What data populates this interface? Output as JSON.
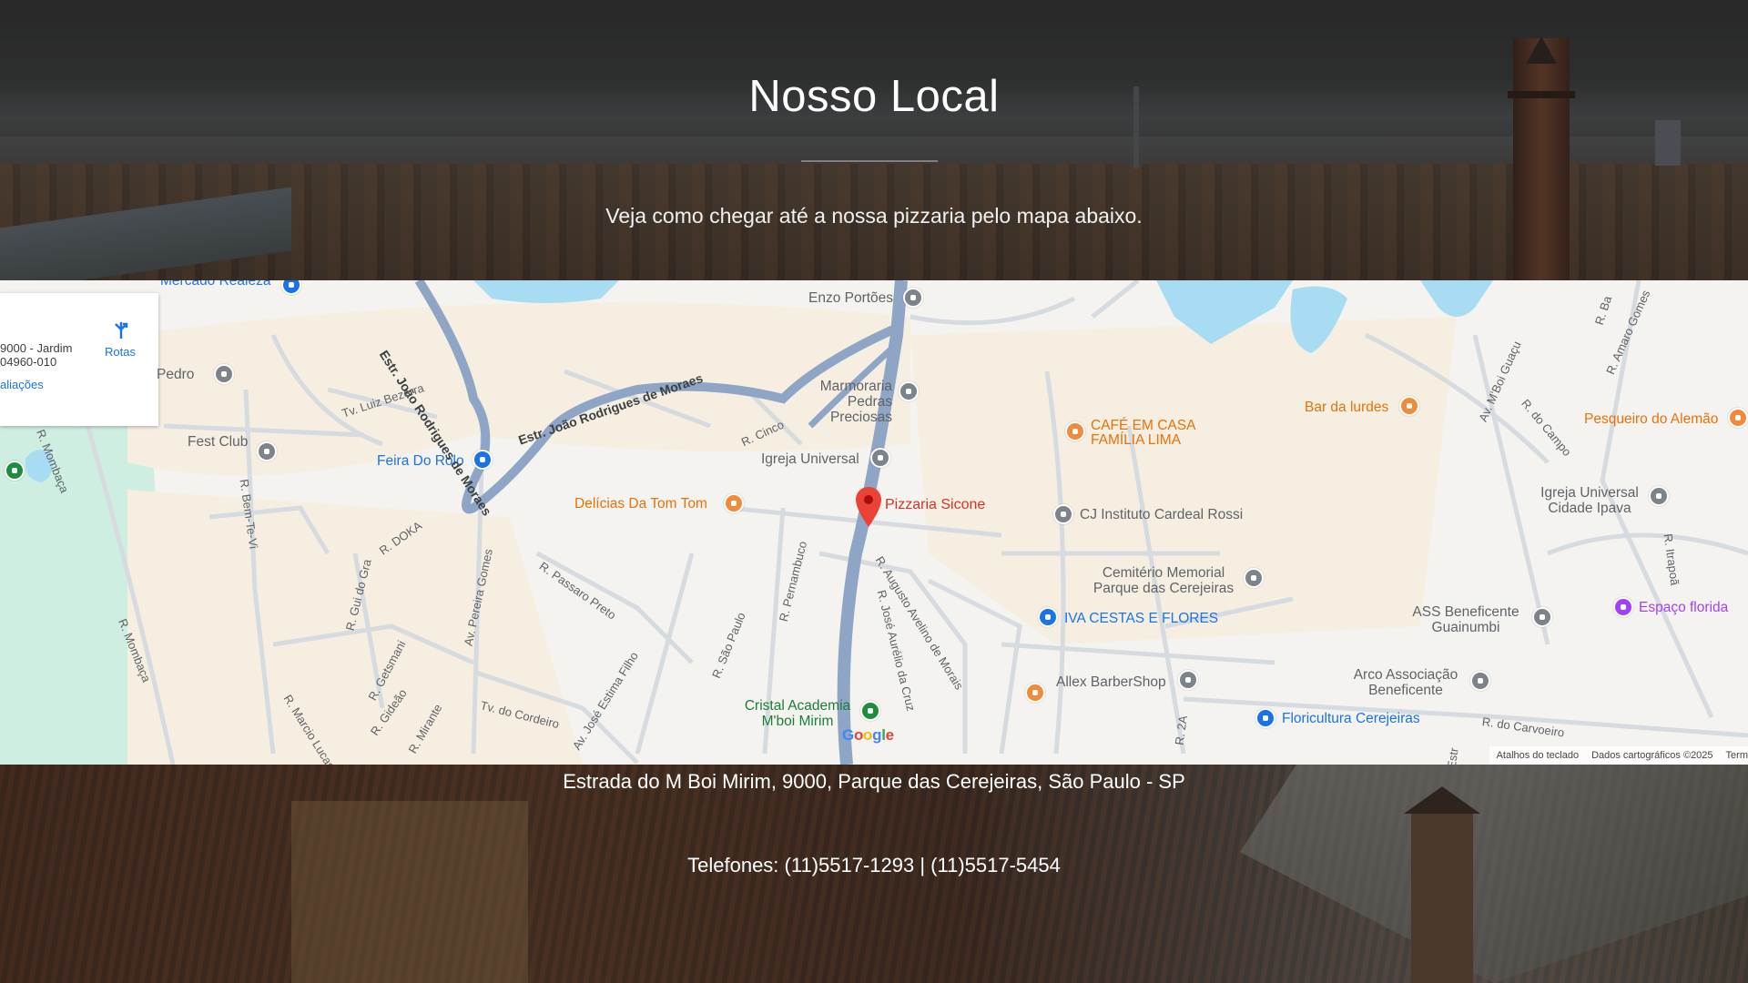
{
  "hero": {
    "title": "Nosso Local",
    "subtitle": "Veja como chegar até a nossa pizzaria pelo mapa abaixo."
  },
  "map": {
    "infocard": {
      "address_line1": "9000 - Jardim",
      "address_line2": "04960-010",
      "reviews_link": "aliações",
      "directions_label": "Rotas"
    },
    "pois": [
      {
        "name": "Mercado Realeza",
        "color": "blue"
      },
      {
        "name": "Enzo Portões",
        "color": "gray"
      },
      {
        "name": "Pedro",
        "color": "gray"
      },
      {
        "name": "Marmoraria Pedras Preciosas",
        "color": "gray"
      },
      {
        "name": "Fest Club",
        "color": "gray"
      },
      {
        "name": "Feira Do Rolo",
        "color": "blue"
      },
      {
        "name": "Igreja Universal",
        "color": "gray"
      },
      {
        "name": "Delícias Da Tom Tom",
        "color": "orange"
      },
      {
        "name": "CAFÉ EM CASA FAMÍLIA LIMA",
        "color": "orange"
      },
      {
        "name": "Bar da lurdes",
        "color": "orange"
      },
      {
        "name": "Pesqueiro do Alemão",
        "color": "orange"
      },
      {
        "name": "CJ Instituto Cardeal Rossi",
        "color": "gray"
      },
      {
        "name": "Igreja Universal Cidade Ipava",
        "color": "gray"
      },
      {
        "name": "Cemitério Memorial Parque das Cerejeiras",
        "color": "gray"
      },
      {
        "name": "IVA CESTAS E FLORES",
        "color": "blue"
      },
      {
        "name": "ASS Beneficente Guainumbi",
        "color": "gray"
      },
      {
        "name": "Espaço florida",
        "color": "purple"
      },
      {
        "name": "Allex BarberShop",
        "color": "gray"
      },
      {
        "name": "Arco Associação Beneficente",
        "color": "gray"
      },
      {
        "name": "Floricultura Cerejeiras",
        "color": "blue"
      },
      {
        "name": "Cristal Academia M'boi Mirim",
        "color": "green"
      }
    ],
    "selected_place": "Pizzaria Sicone",
    "streets": [
      "Estr. João Rodrigues de Moraes",
      "Tv. Luiz Bezerra",
      "R. Cinco",
      "R. Bem-Te-Vi",
      "R. DOKA",
      "R. Gui do Gra",
      "Av. Pereira Gomes",
      "R. Passaro Preto",
      "R. Pernambuco",
      "R. São Paulo",
      "Av. José Estima Filho",
      "Tv. do Cordeiro",
      "R. Mirante",
      "R. Gideão",
      "R. Getsmani",
      "R. Marcio Lucas",
      "R. Mombaça",
      "R. Augusto Avelino de Morais",
      "R. José Aurélio da Cruz",
      "Av. M'Boi Guaçu",
      "R. do Campo",
      "R. Amaro Gomes",
      "R. Itrapoã",
      "R. do Carvoeiro",
      "R. 2A",
      "R. Ba",
      "Estr"
    ],
    "google_letters": [
      "G",
      "o",
      "o",
      "g",
      "l",
      "e"
    ],
    "attribution": [
      "Atalhos do teclado",
      "Dados cartográficos ©2025",
      "Term"
    ]
  },
  "contact": {
    "address": "Estrada do M Boi Mirim, 9000, Parque das Cerejeiras, São Paulo - SP",
    "phones": "Telefones: (11)5517-1293 | (11)5517-5454"
  }
}
